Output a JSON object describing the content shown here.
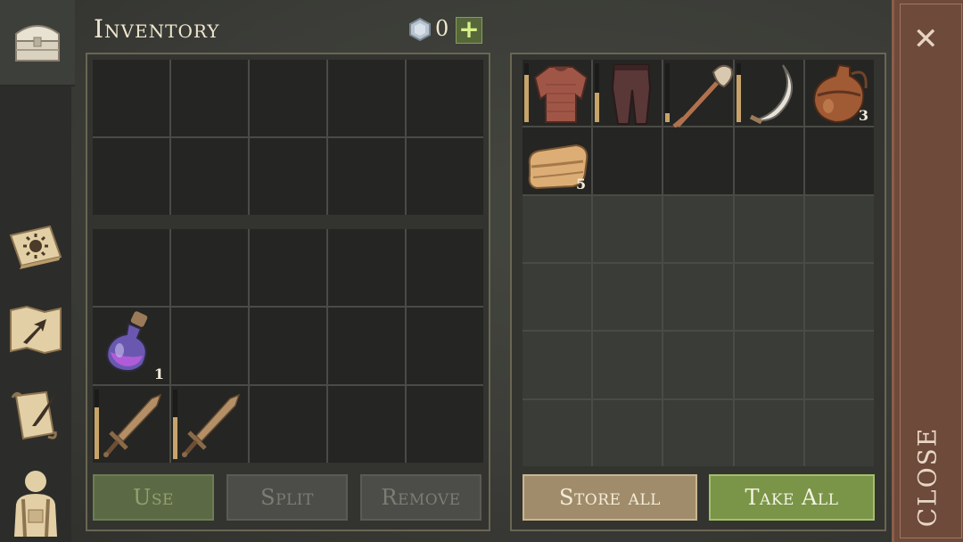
{
  "header": {
    "title": "Inventory",
    "gems": "0",
    "plus": "+"
  },
  "sidebar": {
    "items": [
      "chest-icon",
      "crafting-book-icon",
      "map-icon",
      "quest-scroll-icon",
      "character-icon"
    ]
  },
  "player": {
    "potion_count": "1",
    "durability": {
      "sword1": 0.75,
      "sword2": 0.6
    }
  },
  "container": {
    "items": [
      {
        "name": "chainmail-armor-icon",
        "count": "",
        "durability": 0.8
      },
      {
        "name": "leather-pants-icon",
        "count": "",
        "durability": 0.5
      },
      {
        "name": "shovel-icon",
        "count": "",
        "durability": 0.15
      },
      {
        "name": "scythe-icon",
        "count": "",
        "durability": 0.8
      },
      {
        "name": "flask-icon",
        "count": "3"
      },
      {
        "name": "cloth-icon",
        "count": "5"
      }
    ]
  },
  "buttons": {
    "use": "Use",
    "split": "Split",
    "remove": "Remove",
    "store_all": "Store all",
    "take_all": "Take All"
  },
  "close": {
    "label": "CLOSE",
    "x": "✕"
  },
  "colors": {
    "accent_green": "#7a9548",
    "close_red": "#6e4a3b",
    "bronze": "#a08c6b"
  }
}
